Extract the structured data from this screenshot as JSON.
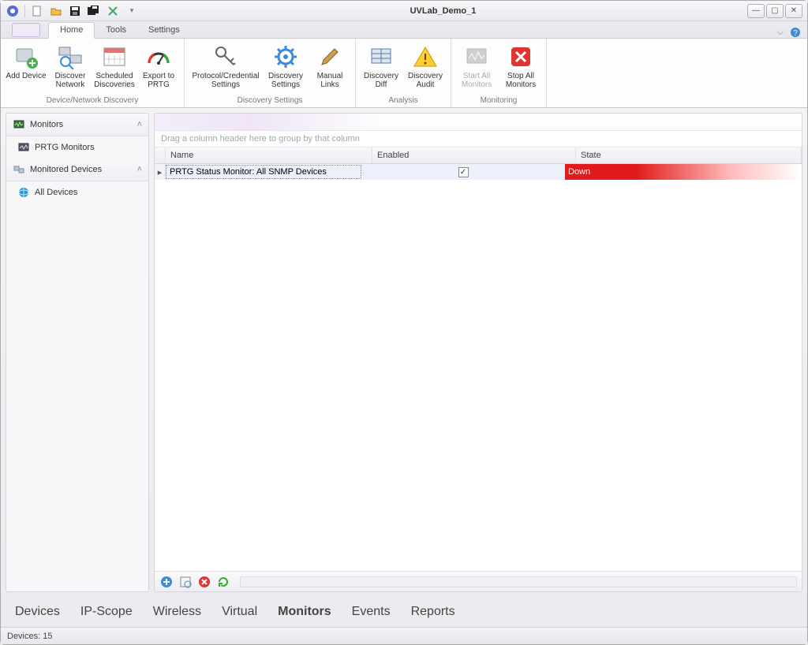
{
  "window": {
    "title": "UVLab_Demo_1"
  },
  "tabs": {
    "home": "Home",
    "tools": "Tools",
    "settings": "Settings"
  },
  "ribbon": {
    "groups": {
      "discovery": {
        "label": "Device/Network Discovery",
        "add_device": "Add Device",
        "discover_network": "Discover Network",
        "scheduled_discoveries": "Scheduled Discoveries",
        "export_prtg": "Export to PRTG"
      },
      "discovery_settings": {
        "label": "Discovery Settings",
        "protocol_credential": "Protocol/Credential Settings",
        "discovery_settings": "Discovery Settings",
        "manual_links": "Manual Links"
      },
      "analysis": {
        "label": "Analysis",
        "discovery_diff": "Discovery Diff",
        "discovery_audit": "Discovery Audit"
      },
      "monitoring": {
        "label": "Monitoring",
        "start_all": "Start All Monitors",
        "stop_all": "Stop All Monitors"
      }
    }
  },
  "sidebar": {
    "monitors": "Monitors",
    "prtg_monitors": "PRTG Monitors",
    "monitored_devices": "Monitored Devices",
    "all_devices": "All Devices"
  },
  "grid": {
    "groupby_hint": "Drag a column header here to group by that column",
    "columns": {
      "name": "Name",
      "enabled": "Enabled",
      "state": "State"
    },
    "rows": [
      {
        "name": "PRTG Status Monitor: All SNMP Devices",
        "enabled": true,
        "state": "Down"
      }
    ]
  },
  "bottom_tabs": {
    "devices": "Devices",
    "ip_scope": "IP-Scope",
    "wireless": "Wireless",
    "virtual": "Virtual",
    "monitors": "Monitors",
    "events": "Events",
    "reports": "Reports"
  },
  "status": {
    "devices": "Devices: 15"
  }
}
